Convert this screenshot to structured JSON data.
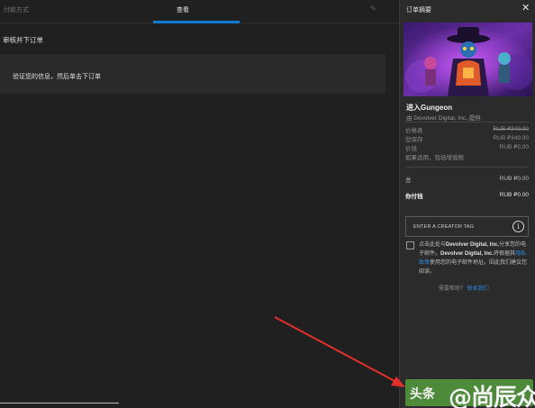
{
  "tabs": {
    "pay": "付款方式",
    "review": "查看"
  },
  "review": {
    "heading": "审核并下订单",
    "info": "验证您的信息，然后单击下订单"
  },
  "summary": {
    "title": "订单摘要",
    "game_title": "进入Gungeon",
    "publisher": "由 Devolver Digital, Inc.,提供",
    "price_label": "价格表",
    "price_value": "RUB ₽349.00",
    "savings_label": "您保存",
    "savings_value": "RUB ₽349.00",
    "cost_label": "价钱",
    "cost_value": "RUB ₽0.00",
    "tax_note": "如果适用，包括增值税",
    "total_label": "总",
    "total_value": "RUB ₽0.00",
    "pay_label": "你付钱",
    "pay_value": "RUB ₽0.00",
    "creator_tag": "ENTER A CREATOR TAG",
    "consent_1": "点击此处与",
    "consent_company_1": "Devolver Digital, Inc.",
    "consent_2": "分享您的电子邮件。",
    "consent_company_2": "Devolver Digital, Inc.",
    "consent_3": "将根据其",
    "consent_link": "隐私政策",
    "consent_4": "使用您的电子邮件地址。因此我们建议您阅读。",
    "help_text": "需要帮助？",
    "help_link": "联系我们"
  },
  "watermark": {
    "part1": "头条",
    "part2": "@尚辰众原"
  },
  "colors": {
    "accent_blue": "#0e7bd3",
    "order_button": "#4d8a3a",
    "annotation_arrow": "#e0302a"
  }
}
